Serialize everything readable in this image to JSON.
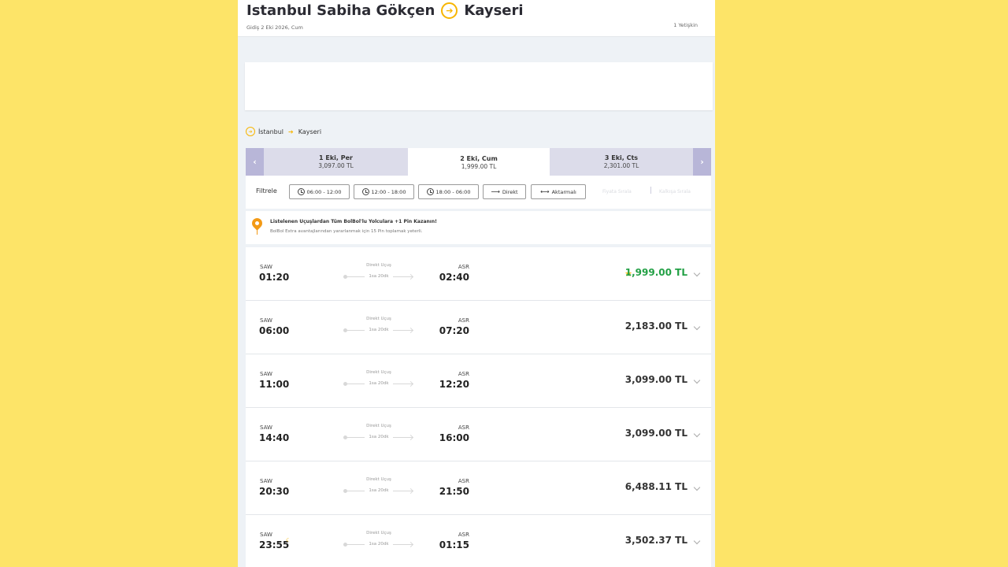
{
  "header": {
    "origin": "Istanbul Sabiha Gökçen",
    "destination": "Kayseri",
    "trip_date": "Gidiş 2 Eki 2026, Cum",
    "passengers": "1 Yetişkin"
  },
  "breadcrumb": {
    "origin": "İstanbul",
    "destination": "Kayseri"
  },
  "date_tabs": [
    {
      "label": "1 Eki, Per",
      "price": "3,097.00 TL"
    },
    {
      "label": "2 Eki, Cum",
      "price": "1,999.00 TL",
      "active": true
    },
    {
      "label": "3 Eki, Cts",
      "price": "2,301.00 TL"
    }
  ],
  "date_nav": {
    "prev": "‹",
    "next": "›"
  },
  "filters": {
    "label": "Filtrele",
    "chips": [
      "06:00 - 12:00",
      "12:00 - 18:00",
      "18:00 - 06:00",
      "Direkt",
      "Aktarmalı"
    ],
    "faint_links": [
      "Fiyata Sırala",
      "Kalkışa Sırala"
    ]
  },
  "promo": {
    "title": "Listelenen Uçuşlardan Tüm BolBol'lu Yolculara +1 Pin Kazanın!",
    "subtitle": "BolBol Extra avantajlarından yararlanmak için 15 Pin toplamak yeterli."
  },
  "flights": [
    {
      "dep_code": "SAW",
      "dep_time": "01:20",
      "type": "Direkt Uçuş",
      "duration": "1sa 20dk",
      "arr_code": "ASR",
      "arr_time": "02:40",
      "price": "1,999.00 TL"
    },
    {
      "dep_code": "SAW",
      "dep_time": "06:00",
      "type": "Direkt Uçuş",
      "duration": "1sa 20dk",
      "arr_code": "ASR",
      "arr_time": "07:20",
      "price": "2,183.00 TL"
    },
    {
      "dep_code": "SAW",
      "dep_time": "11:00",
      "type": "Direkt Uçuş",
      "duration": "1sa 20dk",
      "arr_code": "ASR",
      "arr_time": "12:20",
      "price": "3,099.00 TL"
    },
    {
      "dep_code": "SAW",
      "dep_time": "14:40",
      "type": "Direkt Uçuş",
      "duration": "1sa 20dk",
      "arr_code": "ASR",
      "arr_time": "16:00",
      "price": "3,099.00 TL"
    },
    {
      "dep_code": "SAW",
      "dep_time": "20:30",
      "type": "Direkt Uçuş",
      "duration": "1sa 20dk",
      "arr_code": "ASR",
      "arr_time": "21:50",
      "price": "6,488.11 TL"
    },
    {
      "dep_code": "SAW",
      "dep_time": "23:55",
      "type": "Direkt Uçuş",
      "duration": "1sa 20dk",
      "arr_code": "ASR",
      "arr_time": "01:15",
      "price": "3,502.37 TL"
    }
  ],
  "colors": {
    "background": "#fde468",
    "accent": "#f7b500",
    "best_price": "#22a045",
    "date_nav": "#b8b6d8"
  }
}
